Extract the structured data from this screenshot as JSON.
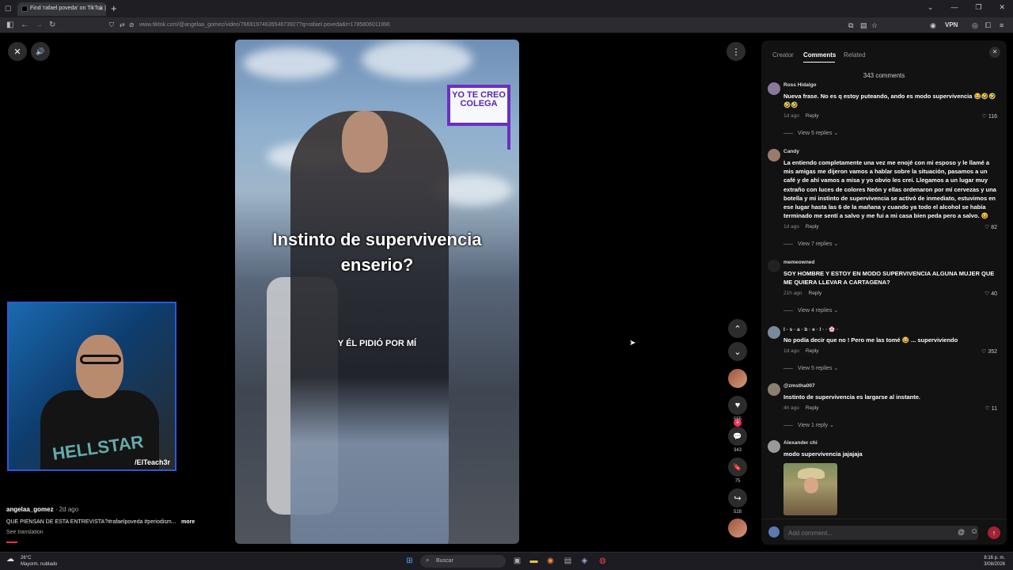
{
  "browser": {
    "tab_title": "Find 'rafael poveda' on TikTok |",
    "tab_close": "×",
    "new_tab": "+",
    "url": "www.tiktok.com/@angelaa_gomez/video/7669197463554673927?q=rafael poveda&t=1785806011996",
    "vpn_label": "VPN",
    "window_controls": [
      "⌄",
      "—",
      "❐",
      "✕"
    ]
  },
  "player": {
    "close_icon": "✕",
    "sound_icon": "🔊",
    "more_icon": "⋮",
    "logo_text": "YO TE CREO COLEGA",
    "caption_main": "Instinto de supervivencia enserio?",
    "caption_sub": "Y ÉL PIDIÓ POR MÍ",
    "webcam_tag": "/ElTeach3r",
    "webcam_shirt": "HELLSTAR"
  },
  "video_info": {
    "author": "angelaa_gomez",
    "time": "· 2d ago",
    "description": "QUE PIENSAN DE ESTA ENTREVISTA?#rafaelpoveda #periodism...",
    "more_label": "more",
    "see_translation": "See translation",
    "progress": 0.05
  },
  "rail": {
    "up_icon": "⌃",
    "down_icon": "⌄",
    "follow_plus": "+",
    "like_icon": "♥",
    "like_count": "555",
    "comment_icon": "💬",
    "comment_count": "343",
    "save_icon": "🔖",
    "save_count": "75",
    "share_icon": "↪",
    "share_count": "528"
  },
  "panel": {
    "tabs": [
      "Creator",
      "Comments",
      "Related"
    ],
    "active_tab": "Comments",
    "close_icon": "✕",
    "comment_count": "343 comments",
    "comments": [
      {
        "user": "Ross Hidalgo",
        "text": "Nueva frase. No es q estoy puteando, ando es modo supervivencia 😂🤣🤣 🤣🤣",
        "time": "1d ago",
        "reply": "Reply",
        "likes": "116",
        "replies": "View 5 replies ⌄"
      },
      {
        "user": "Candy",
        "text": "La entiendo completamente una vez me enojé con mi esposo y le llamé a mis amigas me dijeron vamos a hablar sobre la situación, pasamos a un café y de ahí vamos a misa y yo obvio les creí. Llegamos a un lugar muy extraño con luces de colores Neón y ellas ordenaron por mí cervezas y una botella y mi instinto de supervivencia se activó de inmediato, estuvimos en ese lugar hasta las 6 de la mañana y cuando ya todo el alcohol se había terminado me sentí a salvo y me fui a mi casa bien peda pero a salvo. 😆",
        "time": "1d ago",
        "reply": "Reply",
        "likes": "82",
        "replies": "View 7 replies ⌄"
      },
      {
        "user": "memeowned",
        "text": "SOY HOMBRE Y ESTOY EN MODO SUPERVIVENCIA ALGUNA MUJER QUE ME QUIERA LLEVAR A CARTAGENA?",
        "time": "21h ago",
        "reply": "Reply",
        "likes": "40",
        "replies": "View 4 replies ⌄"
      },
      {
        "user": "I · s · a · b · e · l · ·  🌸 ·",
        "text": "No podía decir que no ! Pero me las tomé 😂 ... superviviendo",
        "time": "1d ago",
        "reply": "Reply",
        "likes": "352",
        "replies": "View 5 replies ⌄"
      },
      {
        "user": "@zmstha007",
        "text": "Instinto de supervivencia es largarse al instante.",
        "time": "4h ago",
        "reply": "Reply",
        "likes": "11",
        "replies": "View 1 reply ⌄"
      },
      {
        "user": "Alexander chi",
        "text": "modo supervivencia jajajaja"
      }
    ],
    "input_placeholder": "Add comment...",
    "at_icon": "@",
    "emoji_icon": "☺",
    "send_icon": "↑"
  },
  "taskbar": {
    "temp": "26°C",
    "weather": "Mayorm. nublado",
    "search_label": "Buscar",
    "time": "8:16 p. m.",
    "date": "3/08/2026"
  },
  "colors": {
    "accent": "#fe2c55",
    "panel_bg": "#121212",
    "logo_purple": "#6a2fc0"
  }
}
